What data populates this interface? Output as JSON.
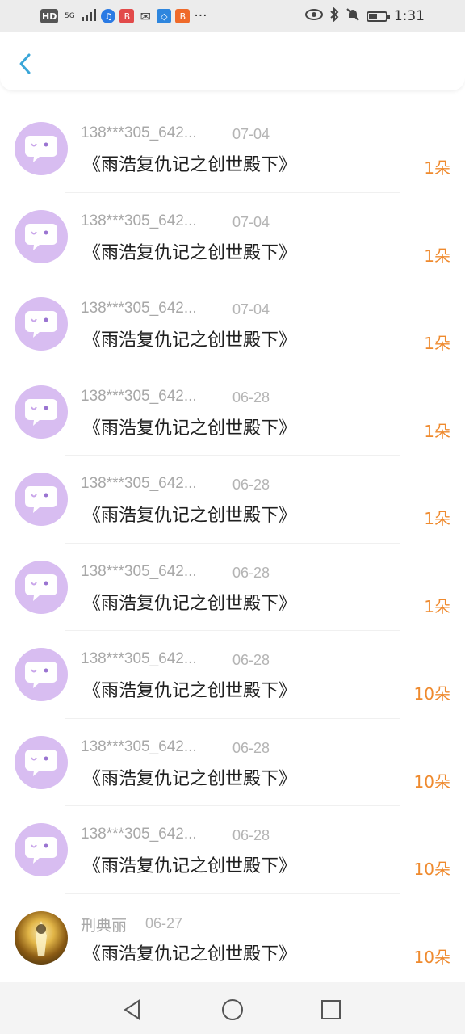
{
  "status_bar": {
    "hd": "HD",
    "network": "5G",
    "time": "1:31",
    "more": "···"
  },
  "header": {
    "back_icon": "back-arrow-icon"
  },
  "records": [
    {
      "sender": "138***305_642...",
      "date": "07-04",
      "title": "《雨浩复仇记之创世殿下》",
      "amount": "1朵",
      "avatar": "chat-bubble-icon"
    },
    {
      "sender": "138***305_642...",
      "date": "07-04",
      "title": "《雨浩复仇记之创世殿下》",
      "amount": "1朵",
      "avatar": "chat-bubble-icon"
    },
    {
      "sender": "138***305_642...",
      "date": "07-04",
      "title": "《雨浩复仇记之创世殿下》",
      "amount": "1朵",
      "avatar": "chat-bubble-icon"
    },
    {
      "sender": "138***305_642...",
      "date": "06-28",
      "title": "《雨浩复仇记之创世殿下》",
      "amount": "1朵",
      "avatar": "chat-bubble-icon"
    },
    {
      "sender": "138***305_642...",
      "date": "06-28",
      "title": "《雨浩复仇记之创世殿下》",
      "amount": "1朵",
      "avatar": "chat-bubble-icon"
    },
    {
      "sender": "138***305_642...",
      "date": "06-28",
      "title": "《雨浩复仇记之创世殿下》",
      "amount": "1朵",
      "avatar": "chat-bubble-icon"
    },
    {
      "sender": "138***305_642...",
      "date": "06-28",
      "title": "《雨浩复仇记之创世殿下》",
      "amount": "10朵",
      "avatar": "chat-bubble-icon"
    },
    {
      "sender": "138***305_642...",
      "date": "06-28",
      "title": "《雨浩复仇记之创世殿下》",
      "amount": "10朵",
      "avatar": "chat-bubble-icon"
    },
    {
      "sender": "138***305_642...",
      "date": "06-28",
      "title": "《雨浩复仇记之创世殿下》",
      "amount": "10朵",
      "avatar": "chat-bubble-icon"
    },
    {
      "sender": "刑典丽",
      "date": "06-27",
      "title": "《雨浩复仇记之创世殿下》",
      "amount": "10朵",
      "avatar": "user-photo"
    }
  ],
  "colors": {
    "accent_blue": "#3aa6d8",
    "amount_orange": "#ef8a2e",
    "avatar_purple": "#d8bdf1"
  }
}
